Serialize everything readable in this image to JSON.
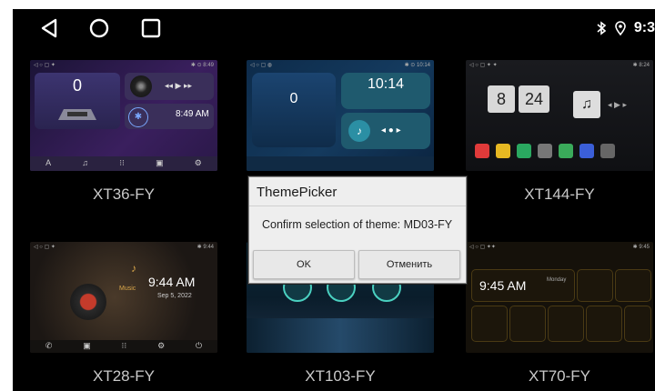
{
  "statusbar": {
    "time": "9:3"
  },
  "themes": [
    {
      "name": "XT36-FY"
    },
    {
      "name": "MD03-FY"
    },
    {
      "name": "XT144-FY"
    },
    {
      "name": "XT28-FY"
    },
    {
      "name": "XT103-FY"
    },
    {
      "name": "XT70-FY"
    }
  ],
  "previews": {
    "xt36": {
      "speed": "0",
      "clock": "8:49 AM",
      "bt": "BT Connected"
    },
    "md03": {
      "speed": "0",
      "clock": "10:14"
    },
    "xt144": {
      "hour": "8",
      "minute": "24"
    },
    "xt28": {
      "clock": "9:44 AM",
      "date": "Sep 5, 2022",
      "music": "Music"
    },
    "xt70": {
      "clock": "9:45 AM",
      "day": "Monday"
    }
  },
  "dialog": {
    "title": "ThemePicker",
    "message": "Confirm selection of theme: MD03-FY",
    "ok_label": "OK",
    "cancel_label": "Отменить"
  },
  "colors": {
    "accent_blue": "#3b7dd8",
    "dialog_bg": "#eeeeee"
  }
}
